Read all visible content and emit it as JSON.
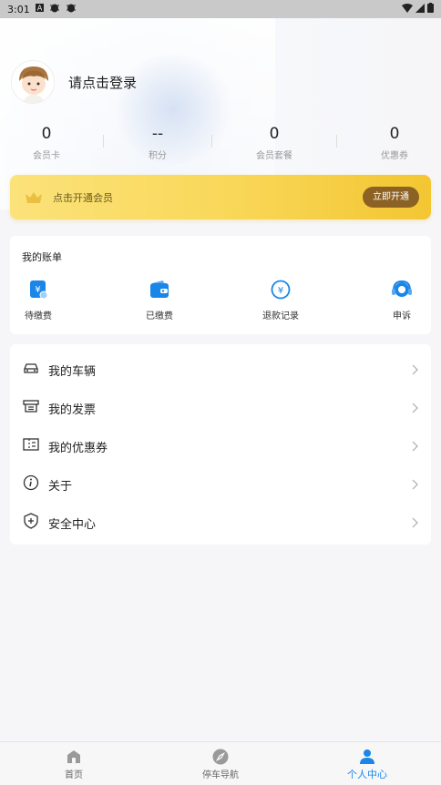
{
  "status_bar": {
    "time": "3:01"
  },
  "profile": {
    "login_prompt": "请点击登录"
  },
  "stats": [
    {
      "value": "0",
      "label": "会员卡"
    },
    {
      "value": "--",
      "label": "积分"
    },
    {
      "value": "0",
      "label": "会员套餐"
    },
    {
      "value": "0",
      "label": "优惠券"
    }
  ],
  "vip": {
    "text": "点击开通会员",
    "button": "立即开通"
  },
  "bills": {
    "title": "我的账单",
    "items": [
      {
        "label": "待缴费",
        "icon": "unpaid-icon"
      },
      {
        "label": "已缴费",
        "icon": "wallet-icon"
      },
      {
        "label": "退款记录",
        "icon": "refund-icon"
      },
      {
        "label": "申诉",
        "icon": "headset-icon"
      }
    ]
  },
  "menu": [
    {
      "label": "我的车辆",
      "icon": "car-icon"
    },
    {
      "label": "我的发票",
      "icon": "invoice-icon"
    },
    {
      "label": "我的优惠券",
      "icon": "coupon-icon"
    },
    {
      "label": "关于",
      "icon": "info-icon"
    },
    {
      "label": "安全中心",
      "icon": "shield-icon"
    }
  ],
  "tabs": [
    {
      "label": "首页",
      "icon": "home-icon"
    },
    {
      "label": "停车导航",
      "icon": "compass-icon"
    },
    {
      "label": "个人中心",
      "icon": "person-icon"
    }
  ],
  "colors": {
    "accent": "#1a86e8",
    "vip_button": "#8c6124",
    "vip_gold": "#f9d85a"
  }
}
